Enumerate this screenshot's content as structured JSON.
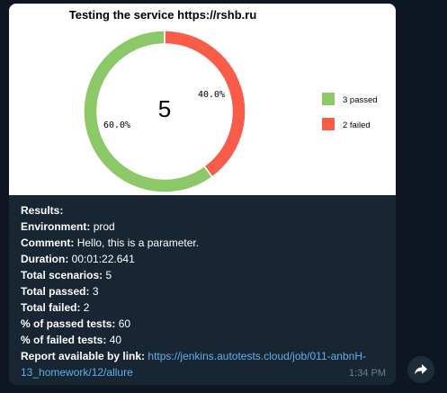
{
  "message": {
    "chart_data": {
      "type": "pie",
      "title": "Testing the service https://rshb.ru",
      "center_label": "5",
      "slices": [
        {
          "label": "3 passed",
          "value": 60.0,
          "display": "60.0%",
          "color": "#8cc768"
        },
        {
          "label": "2 failed",
          "value": 40.0,
          "display": "40.0%",
          "color": "#fa5c4a"
        }
      ],
      "donut": true,
      "legend_position": "right"
    },
    "results": {
      "heading": "Results:",
      "environment_label": "Environment:",
      "environment_value": "prod",
      "comment_label": "Comment:",
      "comment_value": "Hello, this is a parameter.",
      "duration_label": "Duration:",
      "duration_value": "00:01:22.641",
      "total_scenarios_label": "Total scenarios:",
      "total_scenarios_value": "5",
      "total_passed_label": "Total passed:",
      "total_passed_value": "3",
      "total_failed_label": "Total failed:",
      "total_failed_value": "2",
      "passed_pct_label": "% of passed tests:",
      "passed_pct_value": "60",
      "failed_pct_label": "% of failed tests:",
      "failed_pct_value": "40",
      "report_label": "Report available by link:",
      "report_link": "https://jenkins.autotests.cloud/job/011-anbnH-13_homework/12/allure"
    },
    "time": "1:34 PM"
  },
  "share_button": {
    "icon": "share-arrow-icon"
  }
}
